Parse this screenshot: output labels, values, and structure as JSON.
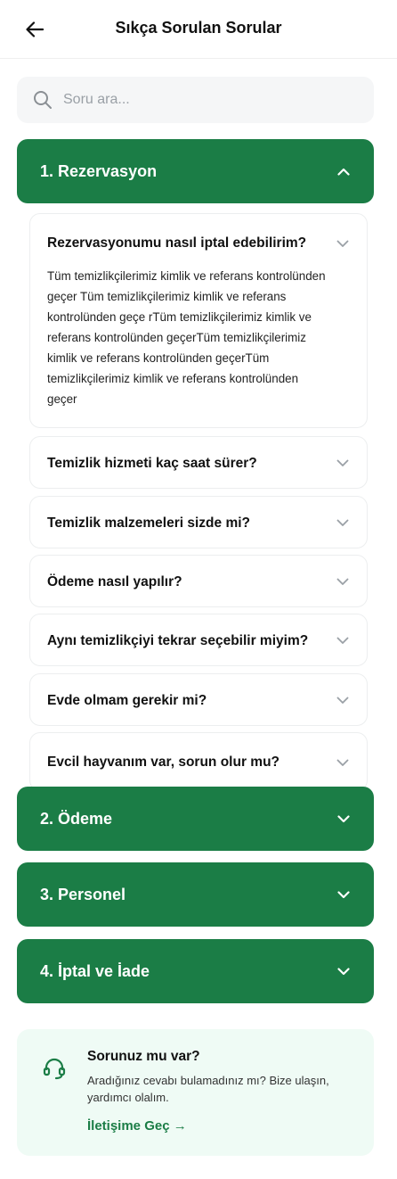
{
  "header": {
    "title": "Sıkça Sorulan Sorular"
  },
  "search": {
    "placeholder": "Soru ara..."
  },
  "sections": [
    {
      "title": "1. Rezervasyon",
      "expanded": true,
      "faqs": [
        {
          "question": "Rezervasyonumu nasıl iptal edebilirim?",
          "answer_lines": [
            "Tüm temizlikçilerimiz kimlik ve referans kontrolünden",
            "geçer Tüm temizlikçilerimiz kimlik ve referans",
            "kontrolünden geçe rTüm temizlikçilerimiz kimlik ve",
            "referans kontrolünden geçerTüm temizlikçilerimiz",
            "kimlik ve referans kontrolünden geçerTüm",
            "temizlikçilerimiz kimlik ve referans kontrolünden",
            "geçer"
          ]
        },
        {
          "question": "Temizlik hizmeti kaç saat sürer?"
        },
        {
          "question": "Temizlik malzemeleri sizde mi?"
        },
        {
          "question": "Ödeme nasıl yapılır?"
        },
        {
          "question": "Aynı temizlikçiyi tekrar seçebilir miyim?"
        },
        {
          "question": "Evde olmam gerekir mi?"
        },
        {
          "question": "Evcil hayvanım var, sorun olur mu?"
        }
      ]
    },
    {
      "title": "2. Ödeme",
      "expanded": false
    },
    {
      "title": "3. Personel",
      "expanded": false
    },
    {
      "title": "4. İptal ve İade",
      "expanded": false
    }
  ],
  "support": {
    "title": "Sorunuz mu var?",
    "text": "Aradığınız cevabı bulamadınız mı? Bize ulaşın, yardımcı olalım.",
    "link": "İletişime Geç →"
  },
  "colors": {
    "primary": "#1b7d46",
    "support_bg": "#effbf5",
    "search_bg": "#f5f6f7"
  },
  "icons": {
    "back": "arrow-left-icon",
    "search": "search-icon",
    "expanded": "chevron-up-icon",
    "collapsed": "chevron-down-icon",
    "support": "headset-icon"
  }
}
